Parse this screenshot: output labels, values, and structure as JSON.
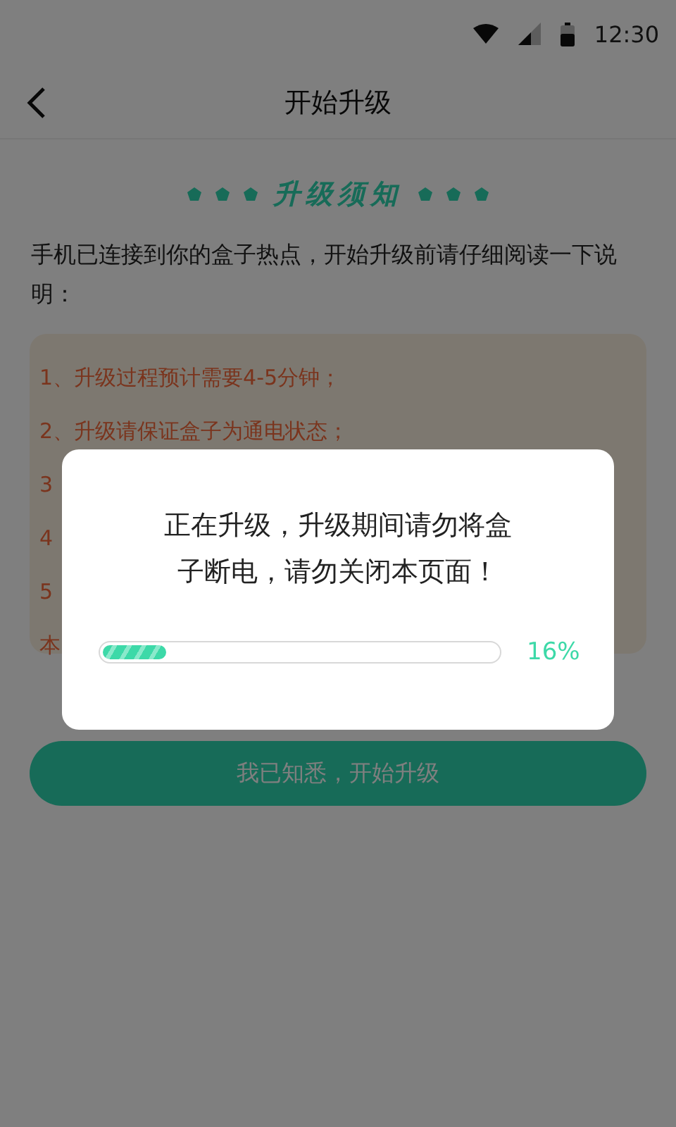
{
  "status_bar": {
    "time": "12:30"
  },
  "nav": {
    "title": "开始升级"
  },
  "notice": {
    "heading": "升级须知",
    "intro": "手机已连接到你的盒子热点，开始升级前请仔细阅读一下说明：",
    "items": [
      "1、升级过程预计需要4-5分钟；",
      "2、升级请保证盒子为通电状态；",
      "3",
      "4",
      "5",
      "本"
    ]
  },
  "confirm_button": "我已知悉，开始升级",
  "dialog": {
    "message": "正在升级，升级期间请勿将盒子断电，请勿关闭本页面！",
    "progress": {
      "level": 0.16,
      "reading": "16%"
    }
  }
}
